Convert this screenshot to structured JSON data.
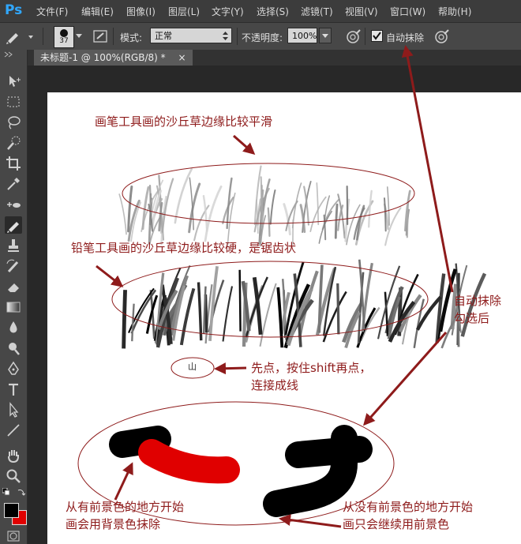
{
  "app": {
    "logo": "Ps"
  },
  "menu": [
    "文件(F)",
    "编辑(E)",
    "图像(I)",
    "图层(L)",
    "文字(Y)",
    "选择(S)",
    "滤镜(T)",
    "视图(V)",
    "窗口(W)",
    "帮助(H)"
  ],
  "options": {
    "brush_size": "37",
    "mode_label": "模式:",
    "mode_value": "正常",
    "opacity_label": "不透明度:",
    "opacity_value": "100%",
    "auto_erase_label": "自动抹除",
    "auto_erase_checked": true
  },
  "document": {
    "tab_title": "未标题-1 @ 100%(RGB/8) *",
    "close": "×"
  },
  "colors": {
    "foreground": "#000000",
    "background": "#e00000",
    "annotation": "#8e1b1b"
  },
  "annotations": {
    "brush": "画笔工具画的沙丘草边缘比较平滑",
    "pencil": "铅笔工具画的沙丘草边缘比较硬，是锯齿状",
    "click_line_1": "先点，按住shift再点，",
    "click_line_2": "连接成线",
    "small_mark": "山",
    "auto_erase_1": "自动抹除",
    "auto_erase_2": "勾选后",
    "with_fg_1": "从有前景色的地方开始",
    "with_fg_2": "画会用背景色抹除",
    "without_fg_1": "从没有前景色的地方开始",
    "without_fg_2": "画只会继续用前景色"
  },
  "tools": [
    "move-icon",
    "marquee-icon",
    "lasso-icon",
    "quick-select-icon",
    "crop-icon",
    "eyedropper-icon",
    "healing-icon",
    "pencil-icon",
    "stamp-icon",
    "history-brush-icon",
    "eraser-icon",
    "gradient-icon",
    "blur-icon",
    "dodge-icon",
    "pen-icon",
    "type-icon",
    "path-select-icon",
    "line-icon",
    "hand-icon",
    "zoom-icon"
  ]
}
